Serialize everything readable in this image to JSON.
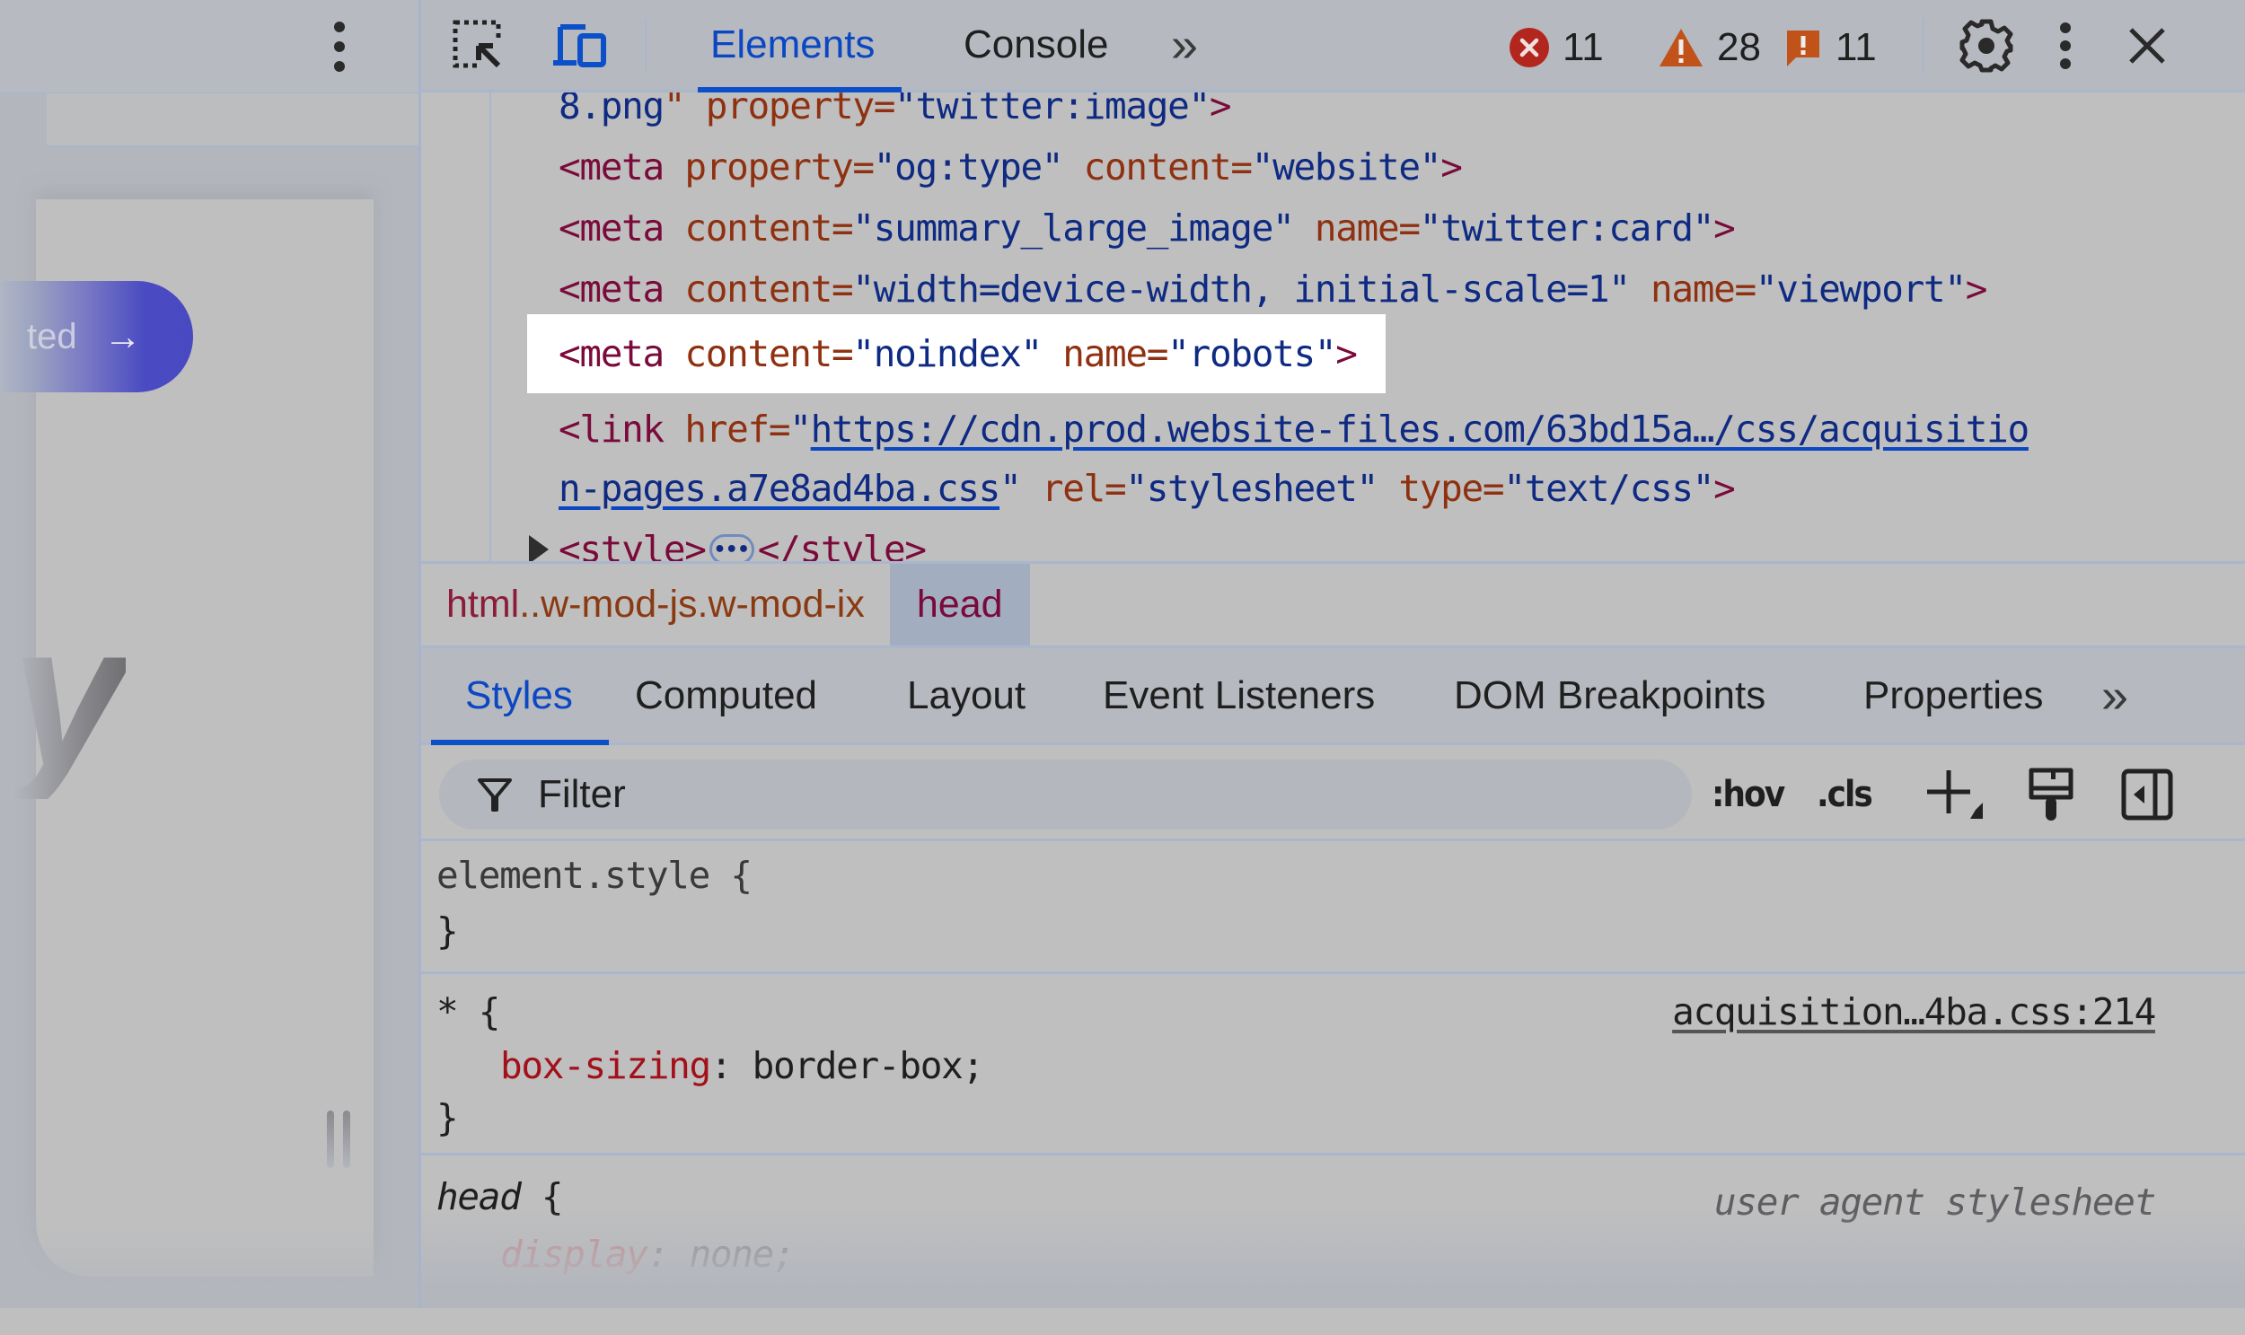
{
  "page_preview": {
    "cta_button_label": "ted",
    "cta_arrow": "→",
    "partial_heading_letter": "y"
  },
  "toolbar": {
    "inspect_icon": "inspect-element-icon",
    "device_icon": "device-toolbar-icon",
    "tabs": [
      {
        "label": "Elements",
        "active": true
      },
      {
        "label": "Console",
        "active": false
      }
    ],
    "more_tabs": "»",
    "errors_count": "11",
    "warnings_count": "28",
    "issues_count": "11",
    "colors": {
      "error": "#b3261e",
      "warning": "#c0521a",
      "issue": "#c0521a",
      "accent": "#0b47c2"
    }
  },
  "dom_tree": {
    "lines": [
      {
        "parts": [
          [
            "val",
            "8.png"
          ],
          [
            "attr",
            "\" property="
          ],
          [
            "val",
            "\"twitter:image\""
          ],
          [
            "tag",
            ">"
          ]
        ]
      },
      {
        "parts": [
          [
            "tag",
            "<meta "
          ],
          [
            "attr",
            "property="
          ],
          [
            "val",
            "\"og:type\""
          ],
          [
            "attr",
            " content="
          ],
          [
            "val",
            "\"website\""
          ],
          [
            "tag",
            ">"
          ]
        ]
      },
      {
        "parts": [
          [
            "tag",
            "<meta "
          ],
          [
            "attr",
            "content="
          ],
          [
            "val",
            "\"summary_large_image\""
          ],
          [
            "attr",
            " name="
          ],
          [
            "val",
            "\"twitter:card\""
          ],
          [
            "tag",
            ">"
          ]
        ]
      },
      {
        "parts": [
          [
            "tag",
            "<meta "
          ],
          [
            "attr",
            "content="
          ],
          [
            "val",
            "\"width=device-width, initial-scale=1\""
          ],
          [
            "attr",
            " name="
          ],
          [
            "val",
            "\"viewport\""
          ],
          [
            "tag",
            ">"
          ]
        ]
      },
      {
        "highlighted": true,
        "parts": [
          [
            "tag",
            "<meta "
          ],
          [
            "attr",
            "content="
          ],
          [
            "val",
            "\"noindex\""
          ],
          [
            "attr",
            " name="
          ],
          [
            "val",
            "\"robots\""
          ],
          [
            "tag",
            ">"
          ]
        ]
      },
      {
        "parts": [
          [
            "tag",
            "<link "
          ],
          [
            "attr",
            "href="
          ],
          [
            "val",
            "\""
          ],
          [
            "link",
            "https://cdn.prod.website-files.com/63bd15a…/css/acquisitio"
          ]
        ]
      },
      {
        "parts": [
          [
            "link",
            "n-pages.a7e8ad4ba.css"
          ],
          [
            "val",
            "\""
          ],
          [
            "attr",
            " rel="
          ],
          [
            "val",
            "\"stylesheet\""
          ],
          [
            "attr",
            " type="
          ],
          [
            "val",
            "\"text/css\""
          ],
          [
            "tag",
            ">"
          ]
        ]
      },
      {
        "expandable": true,
        "parts": [
          [
            "tag",
            "<style>"
          ],
          [
            "ellipsis",
            "•••"
          ],
          [
            "tag",
            "</style>"
          ]
        ]
      }
    ]
  },
  "breadcrumb": {
    "items": [
      {
        "tag": "html",
        "classes": "..w-mod-js.w-mod-ix",
        "active": false
      },
      {
        "tag": "head",
        "classes": "",
        "active": true
      }
    ]
  },
  "sidebar_tabs": {
    "items": [
      {
        "label": "Styles",
        "active": true
      },
      {
        "label": "Computed",
        "active": false
      },
      {
        "label": "Layout",
        "active": false
      },
      {
        "label": "Event Listeners",
        "active": false
      },
      {
        "label": "DOM Breakpoints",
        "active": false
      },
      {
        "label": "Properties",
        "active": false
      }
    ],
    "more": "»"
  },
  "filter": {
    "placeholder": "Filter",
    "value": "",
    "hov_label": ":hov",
    "cls_label": ".cls"
  },
  "styles": {
    "rules": [
      {
        "selector": "element.style {",
        "close": "}",
        "declarations": []
      },
      {
        "selector": "* {",
        "close": "}",
        "source": "acquisition…4ba.css:214",
        "declarations": [
          {
            "property": "box-sizing",
            "value": "border-box;"
          }
        ]
      },
      {
        "selector": "head",
        "brace": " {",
        "source": "user agent stylesheet",
        "declarations": [
          {
            "property": "display",
            "value": "none;",
            "faded": true
          }
        ]
      }
    ]
  }
}
